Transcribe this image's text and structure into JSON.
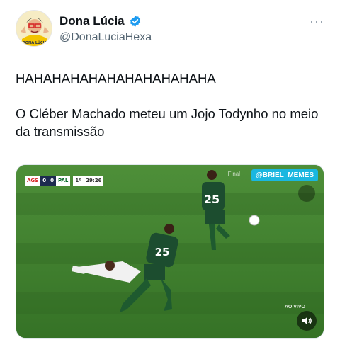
{
  "author": {
    "display_name": "Dona Lúcia",
    "handle": "@DonaLuciaHexa",
    "avatar_text": "DONA LÚCIA",
    "verified_color": "#1d9bf0"
  },
  "more_label": "···",
  "tweet": {
    "line1": "HAHAHAHAHAHAHAHAHAHAHA",
    "line2": "O Cléber Machado meteu um Jojo Todynho no meio da transmissão"
  },
  "media": {
    "scoreboard": {
      "team_a": "AGS",
      "score_a": "0",
      "score_b": "0",
      "team_b": "PAL",
      "period": "1º",
      "clock": "29:26"
    },
    "watermark": "@BRIEL_MEMES",
    "broadcaster_tag": "Final",
    "player_number_1": "25",
    "player_number_2": "25",
    "live_label": "AO VIVO",
    "pitch_color": "#3c7b2e"
  }
}
